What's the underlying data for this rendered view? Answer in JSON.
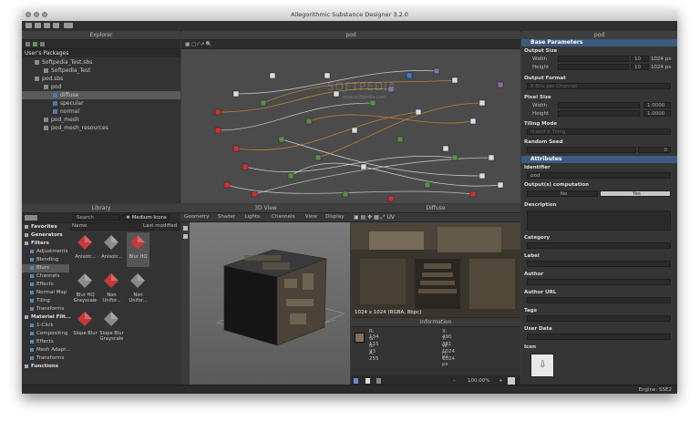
{
  "window": {
    "title": "Allegorithmic Substance Designer 3.2.0"
  },
  "watermark": "SOFTPEDIA",
  "watermark_url": "www.softpedia.com",
  "explorer": {
    "title": "Explorer",
    "section": "User's Packages",
    "items": [
      {
        "label": "Softpedia_Test.sbs",
        "indent": 1
      },
      {
        "label": "Softpedia_Test",
        "indent": 2
      },
      {
        "label": "pod.sbs",
        "indent": 1
      },
      {
        "label": "pod",
        "indent": 2
      },
      {
        "label": "diffuse",
        "indent": 3
      },
      {
        "label": "specular",
        "indent": 3
      },
      {
        "label": "normal",
        "indent": 3
      },
      {
        "label": "pod_mesh",
        "indent": 2
      },
      {
        "label": "pod_mesh_resources",
        "indent": 2
      }
    ]
  },
  "graph": {
    "title": "pod"
  },
  "library": {
    "title": "Library",
    "search_placeholder": "Search",
    "view_mode": "Medium Icons",
    "columns": [
      "Name",
      "Last modified"
    ],
    "categories": [
      {
        "label": "Favorites",
        "level": 0
      },
      {
        "label": "Generators",
        "level": 0
      },
      {
        "label": "Filters",
        "level": 0
      },
      {
        "label": "Adjustments",
        "level": 1
      },
      {
        "label": "Blending",
        "level": 1
      },
      {
        "label": "Blurs",
        "level": 1
      },
      {
        "label": "Channels",
        "level": 1
      },
      {
        "label": "Effects",
        "level": 1
      },
      {
        "label": "Normal Map",
        "level": 1
      },
      {
        "label": "Tiling",
        "level": 1
      },
      {
        "label": "Transforms",
        "level": 1
      },
      {
        "label": "Material Filt...",
        "level": 0
      },
      {
        "label": "1-Click",
        "level": 1
      },
      {
        "label": "Compositing",
        "level": 1
      },
      {
        "label": "Effects",
        "level": 1
      },
      {
        "label": "Mesh Adapt...",
        "level": 1
      },
      {
        "label": "Transforms",
        "level": 1
      },
      {
        "label": "Functions",
        "level": 0
      }
    ],
    "tiles": [
      {
        "label": "Anisotr...",
        "color": "#c43a3a"
      },
      {
        "label": "Anisotr...",
        "color": "#8a8a8a"
      },
      {
        "label": "Blur HQ",
        "color": "#c43a3a"
      },
      {
        "label": "Blur HQ Grayscale",
        "color": "#8a8a8a"
      },
      {
        "label": "Non Unifor...",
        "color": "#c43a3a"
      },
      {
        "label": "Non Unifor...",
        "color": "#8a8a8a"
      },
      {
        "label": "Slope Blur",
        "color": "#c43a3a"
      },
      {
        "label": "Slope Blur Grayscale",
        "color": "#8a8a8a"
      }
    ]
  },
  "view3d": {
    "title": "3D View",
    "menu": [
      "Geometry",
      "Shader",
      "Lights",
      "Channels",
      "View",
      "Display"
    ]
  },
  "view2d": {
    "title": "Diffuse",
    "image_info": "1024 x 1024 (RGBA, 8bpc)",
    "info_title": "Information",
    "info": [
      {
        "k": "R:",
        "v": "134"
      },
      {
        "k": "G:",
        "v": "115"
      },
      {
        "k": "B:",
        "v": "93"
      },
      {
        "k": "A:",
        "v": "255"
      }
    ],
    "coords": [
      {
        "k": "X:",
        "v": "490"
      },
      {
        "k": "Y:",
        "v": "381"
      },
      {
        "k": "W:",
        "v": "1024 px"
      },
      {
        "k": "H:",
        "v": "1024 px"
      }
    ],
    "zoom": "100.00%",
    "swatch_color": "#866c5d"
  },
  "params": {
    "title": "pod",
    "base_section": "Base Parameters",
    "output_size_label": "Output Size",
    "width_label": "Width",
    "width_value": "10",
    "width_px": "1024 px",
    "height_label": "Height",
    "height_value": "10",
    "height_px": "1024 px",
    "output_format_label": "Output Format",
    "output_format_value": "8 Bits per Channel",
    "pixel_size_label": "Pixel Size",
    "pixel_width_value": "1.0000",
    "pixel_height_value": "1.0000",
    "tiling_mode_label": "Tiling Mode",
    "tiling_mode_value": "H and V Tiling",
    "random_seed_label": "Random Seed",
    "random_seed_value": "0",
    "attributes_section": "Attributes",
    "identifier_label": "Identifier",
    "identifier_value": "pod",
    "outputs_label": "Output(s) computation",
    "no_label": "No",
    "yes_label": "Yes",
    "description_label": "Description",
    "category_label": "Category",
    "label_label": "Label",
    "author_label": "Author",
    "author_url_label": "Author URL",
    "tags_label": "Tags",
    "user_data_label": "User Data",
    "icon_label": "Icon"
  },
  "status": {
    "engine": "Engine: SSE2"
  },
  "colors": {
    "accent_blue": "#3d5a80",
    "node_red": "#c33",
    "node_green": "#5b8c4a",
    "wire_orange": "#d08a30"
  }
}
